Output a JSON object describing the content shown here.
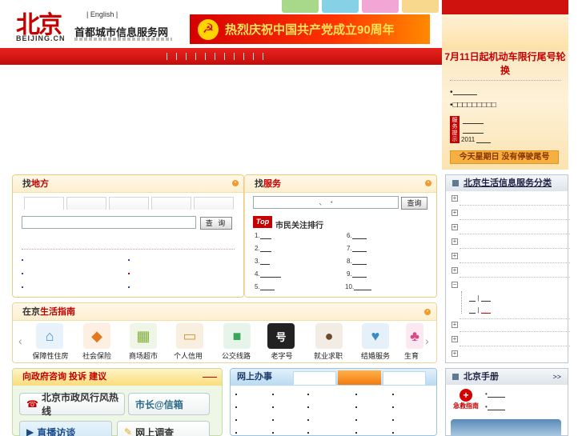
{
  "header": {
    "logo_cn": "北京",
    "logo_en": "BEIJING.CN",
    "english_link": "| English |",
    "site_name": "首都城市信息服务网",
    "banner_text": "热烈庆祝中国共产党成立90周年",
    "top_tab_colors": [
      "#a8d88a",
      "#86d1e6",
      "#f2a6d6",
      "#f8d88c"
    ],
    "nav_separators": 11
  },
  "notice": {
    "title": "7月11日起机动车限行尾号轮换",
    "line1": "•",
    "line2": "•□□□□□□□□□",
    "tag": "服务提示",
    "year": "2011",
    "button": "今天星期日 没有停驶尾号"
  },
  "find_place": {
    "title_a": "找",
    "title_b": "地方",
    "search_button": "查 询"
  },
  "find_service": {
    "title_a": "找",
    "title_b": "服务",
    "input_value": "、 ・",
    "search_button": "查询",
    "top_badge": "Top",
    "ranking_title": "市民关注排行",
    "ranks_left": [
      "1.",
      "2.",
      "3.",
      "4.",
      "5."
    ],
    "ranks_right": [
      "6.",
      "7.",
      "8.",
      "9.",
      "10."
    ]
  },
  "guide": {
    "title_a": "在京",
    "title_b": "生活指南",
    "items": [
      {
        "label": "保障性住房",
        "icon": "house-icon",
        "glyph": "⌂",
        "color": "#3a8fd6"
      },
      {
        "label": "社会保险",
        "icon": "shield-icon",
        "glyph": "◆",
        "color": "#e07a1c"
      },
      {
        "label": "商场超市",
        "icon": "cart-icon",
        "glyph": "▦",
        "color": "#7fae3a"
      },
      {
        "label": "个人信用",
        "icon": "id-card-icon",
        "glyph": "▭",
        "color": "#d49a3a"
      },
      {
        "label": "公交线路",
        "icon": "bus-icon",
        "glyph": "■",
        "color": "#3aa65a"
      },
      {
        "label": "老字号",
        "icon": "laozihao-icon",
        "glyph": "号",
        "color": "#333333"
      },
      {
        "label": "就业求职",
        "icon": "job-icon",
        "glyph": "●",
        "color": "#6a4a2a"
      },
      {
        "label": "结婚服务",
        "icon": "couple-icon",
        "glyph": "♥",
        "color": "#3a8ac6"
      },
      {
        "label": "生育",
        "icon": "stroller-icon",
        "glyph": "♣",
        "color": "#d64a8a"
      }
    ]
  },
  "life_services": {
    "title": "北京生活信息服务分类"
  },
  "gov": {
    "title": "向政府咨询 投诉 建议",
    "hotline": "北京市政风行风热线",
    "mayor": "市长@信箱",
    "live": "直播访谈",
    "survey": "网上调查"
  },
  "online": {
    "title": "网上办事"
  },
  "handbook": {
    "title": "北京手册",
    "more": ">>",
    "emergency": "急救指南"
  }
}
